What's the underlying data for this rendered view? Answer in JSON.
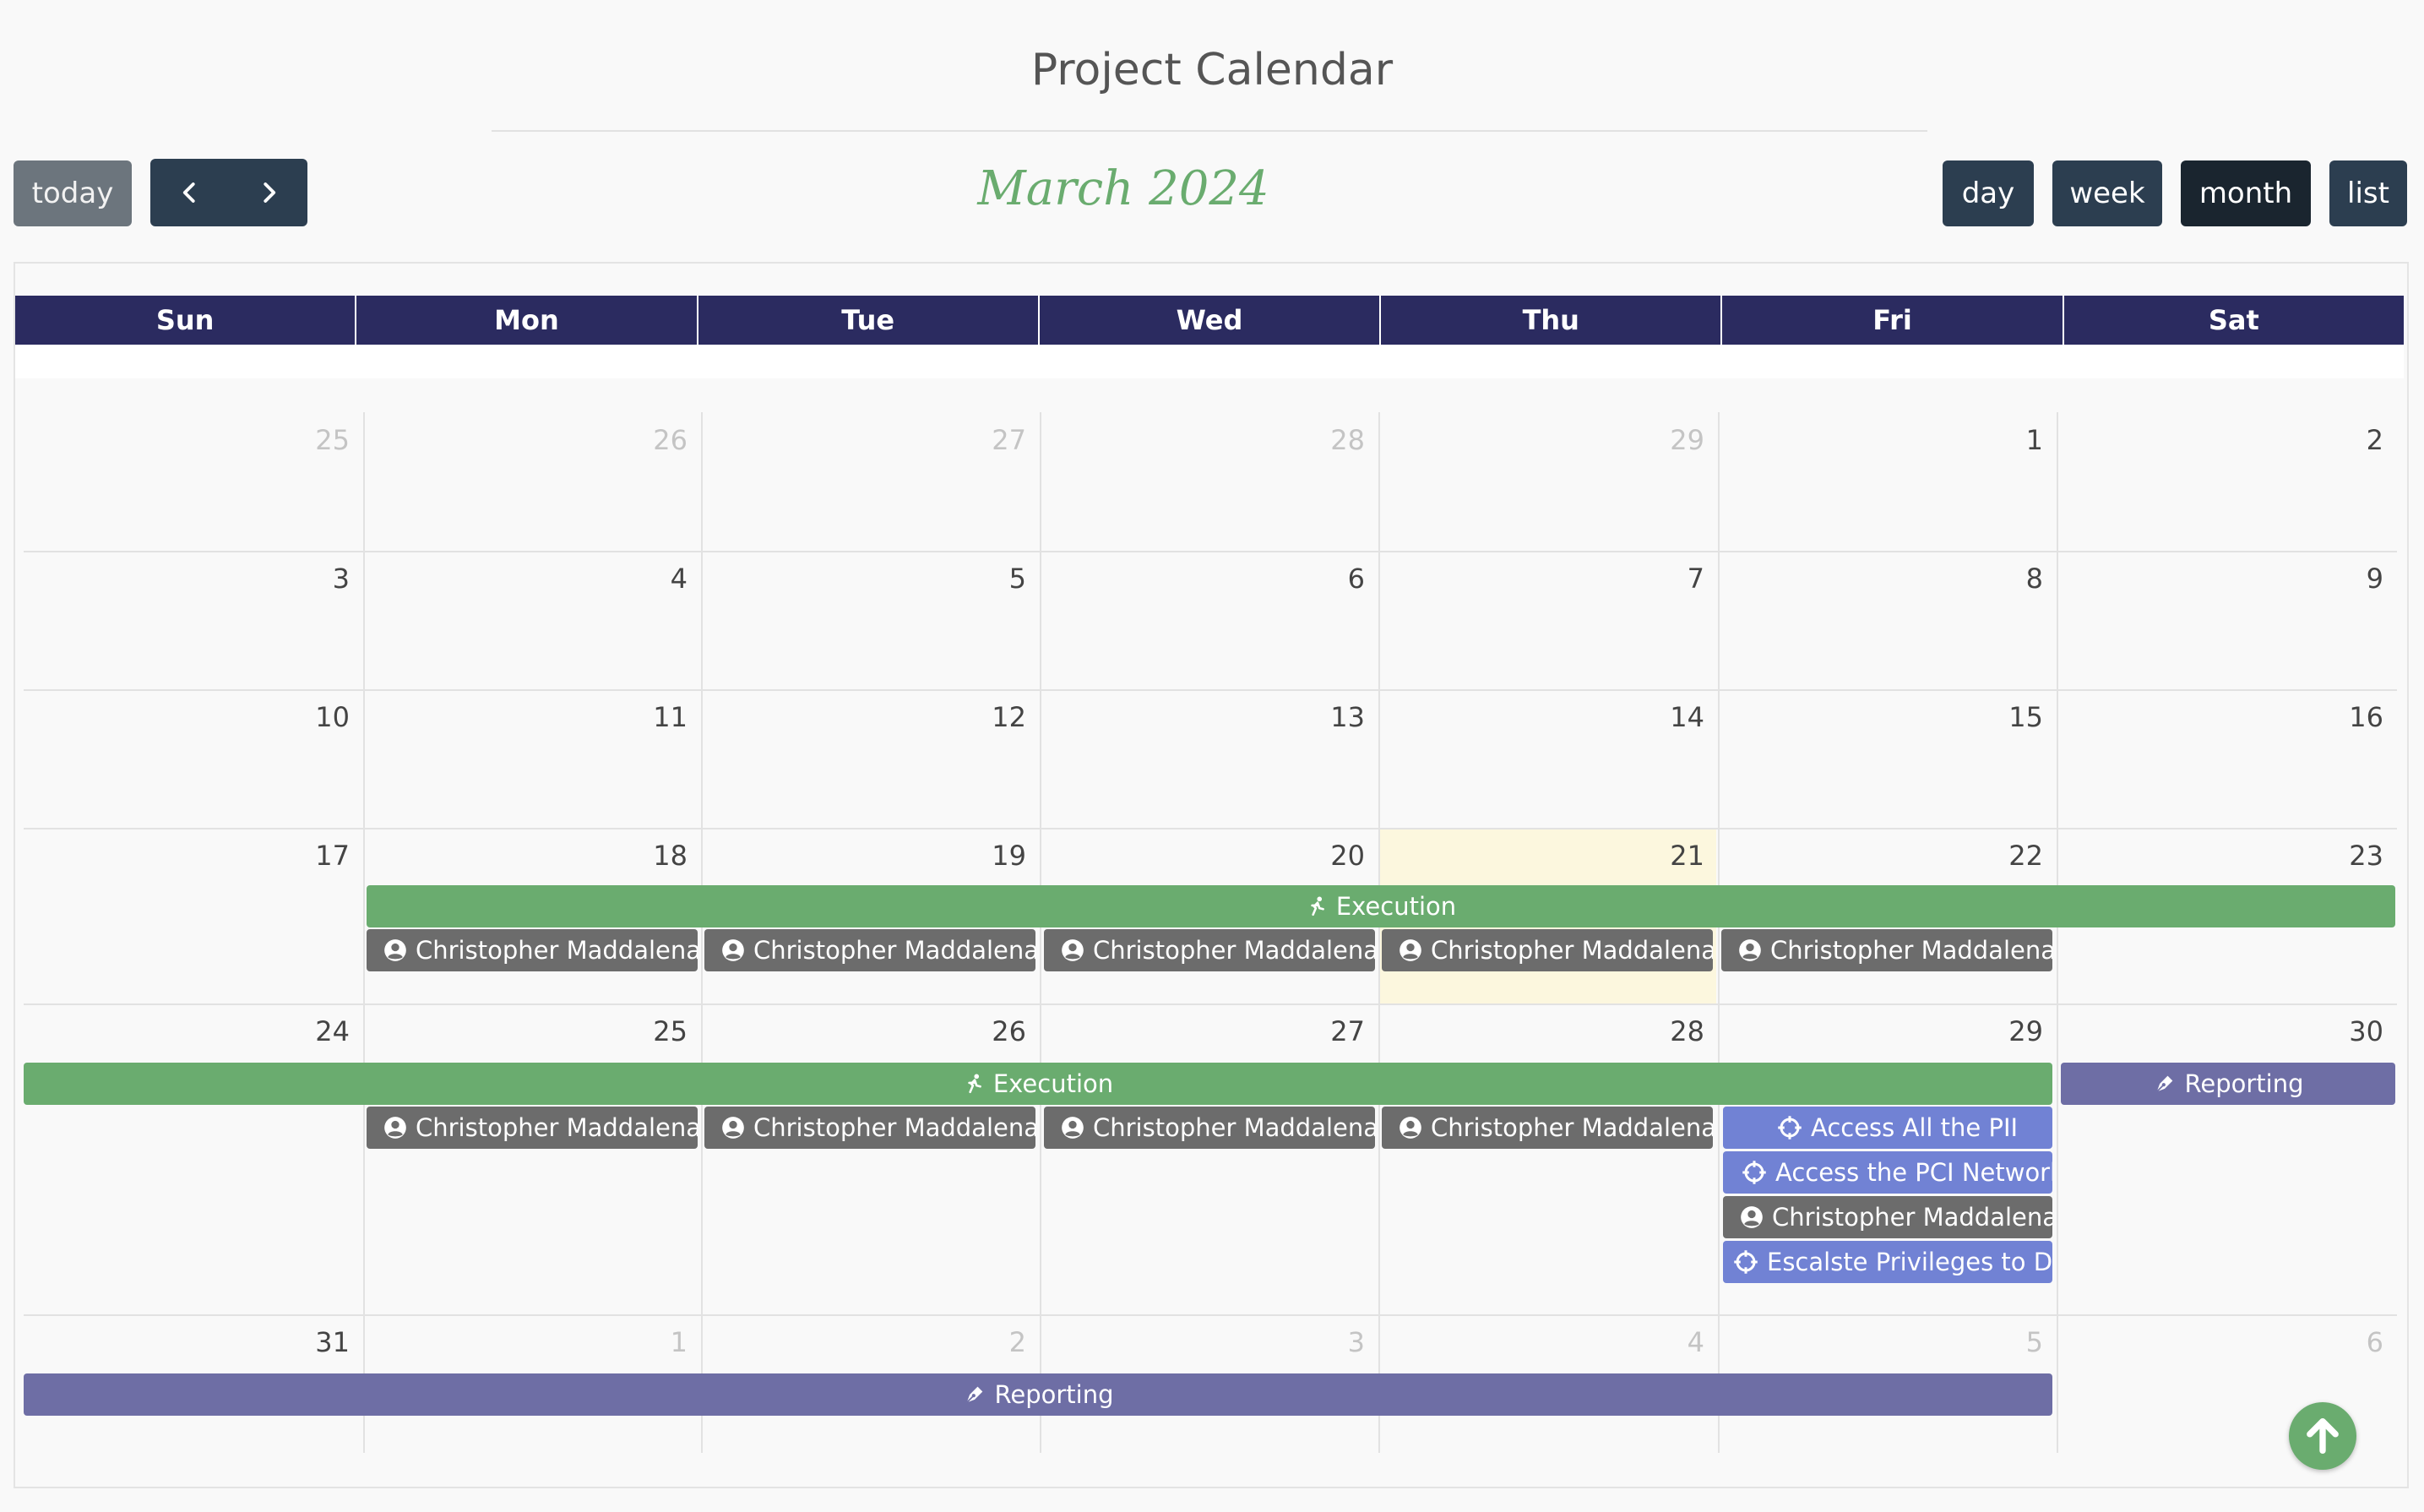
{
  "header": {
    "title": "Project Calendar"
  },
  "toolbar": {
    "today_label": "today",
    "month_label": "March 2024",
    "views": {
      "day": "day",
      "week": "week",
      "month": "month",
      "list": "list"
    },
    "active_view": "month"
  },
  "weekdays": [
    "Sun",
    "Mon",
    "Tue",
    "Wed",
    "Thu",
    "Fri",
    "Sat"
  ],
  "weeks": [
    {
      "days": [
        {
          "n": "25",
          "cur": false
        },
        {
          "n": "26",
          "cur": false
        },
        {
          "n": "27",
          "cur": false
        },
        {
          "n": "28",
          "cur": false
        },
        {
          "n": "29",
          "cur": false
        },
        {
          "n": "1",
          "cur": true
        },
        {
          "n": "2",
          "cur": true
        }
      ]
    },
    {
      "days": [
        {
          "n": "3",
          "cur": true
        },
        {
          "n": "4",
          "cur": true
        },
        {
          "n": "5",
          "cur": true
        },
        {
          "n": "6",
          "cur": true
        },
        {
          "n": "7",
          "cur": true
        },
        {
          "n": "8",
          "cur": true
        },
        {
          "n": "9",
          "cur": true
        }
      ]
    },
    {
      "days": [
        {
          "n": "10",
          "cur": true
        },
        {
          "n": "11",
          "cur": true
        },
        {
          "n": "12",
          "cur": true
        },
        {
          "n": "13",
          "cur": true
        },
        {
          "n": "14",
          "cur": true
        },
        {
          "n": "15",
          "cur": true
        },
        {
          "n": "16",
          "cur": true
        }
      ]
    },
    {
      "days": [
        {
          "n": "17",
          "cur": true
        },
        {
          "n": "18",
          "cur": true
        },
        {
          "n": "19",
          "cur": true
        },
        {
          "n": "20",
          "cur": true
        },
        {
          "n": "21",
          "cur": true,
          "today": true
        },
        {
          "n": "22",
          "cur": true
        },
        {
          "n": "23",
          "cur": true
        }
      ]
    },
    {
      "days": [
        {
          "n": "24",
          "cur": true
        },
        {
          "n": "25",
          "cur": true
        },
        {
          "n": "26",
          "cur": true
        },
        {
          "n": "27",
          "cur": true
        },
        {
          "n": "28",
          "cur": true
        },
        {
          "n": "29",
          "cur": true
        },
        {
          "n": "30",
          "cur": true
        }
      ]
    },
    {
      "days": [
        {
          "n": "31",
          "cur": true
        },
        {
          "n": "1",
          "cur": false
        },
        {
          "n": "2",
          "cur": false
        },
        {
          "n": "3",
          "cur": false
        },
        {
          "n": "4",
          "cur": false
        },
        {
          "n": "5",
          "cur": false
        },
        {
          "n": "6",
          "cur": false
        }
      ]
    }
  ],
  "events": {
    "execution_week4": "Execution",
    "execution_week5": "Execution",
    "reporting_week5": "Reporting",
    "reporting_week6": "Reporting",
    "person": "Christopher Maddalena",
    "target_pii": "Access All the PII",
    "target_pci": "Access the PCI Network",
    "target_escalate": "Escalste Privileges to Dom"
  },
  "icons": {
    "prev": "chevron-left-icon",
    "next": "chevron-right-icon",
    "execution": "running-person-icon",
    "reporting": "pen-nib-icon",
    "person": "user-circle-icon",
    "target": "crosshairs-icon",
    "scroll_top": "arrow-up-circle-icon"
  },
  "colors": {
    "header_bg": "#2b2b60",
    "execution": "#6aac6f",
    "reporting": "#6e6ea5",
    "person": "#6c6c6c",
    "target": "#7182d4",
    "today_bg": "#fcf7de",
    "month_label": "#6aac6f"
  }
}
